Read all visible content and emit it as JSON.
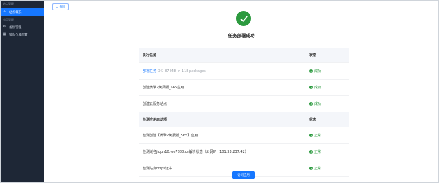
{
  "sidebar": {
    "header": "站点管理",
    "items": [
      {
        "label": "站点概况",
        "icon": "home-icon",
        "active": true
      }
    ],
    "group_label": "应用管理",
    "group_items": [
      {
        "label": "备份管理",
        "icon": "gear-icon"
      },
      {
        "label": "镜像仓库配置",
        "icon": "grid-icon"
      }
    ]
  },
  "back_label": "返回",
  "title": "任务部署成功",
  "section1": {
    "header_task": "执行任务",
    "header_status": "状态",
    "rows": [
      {
        "task_link": "部署任务",
        "task_extra": "OK: 87 MiB in 118 packages",
        "status": "成功"
      },
      {
        "task": "创建微擎2免费版_565应用",
        "status": "成功"
      },
      {
        "task": "创建云服务站点",
        "status": "成功"
      }
    ]
  },
  "section2": {
    "header_task": "检测应用启动项",
    "header_status": "状态",
    "rows": [
      {
        "task": "检测创建【微擎2免费版_565】应用",
        "status": "正常"
      },
      {
        "task": "检测域名jiqun10.we7888.cn解析状态（公网IP：101.33.237.42）",
        "status": "正常"
      },
      {
        "task": "检测站点https证书",
        "status": "正常"
      }
    ]
  },
  "visit_button": "访问应用",
  "colors": {
    "accent": "#1677ff",
    "success": "#2c9a3f",
    "sidebar_bg": "#1e2736"
  }
}
